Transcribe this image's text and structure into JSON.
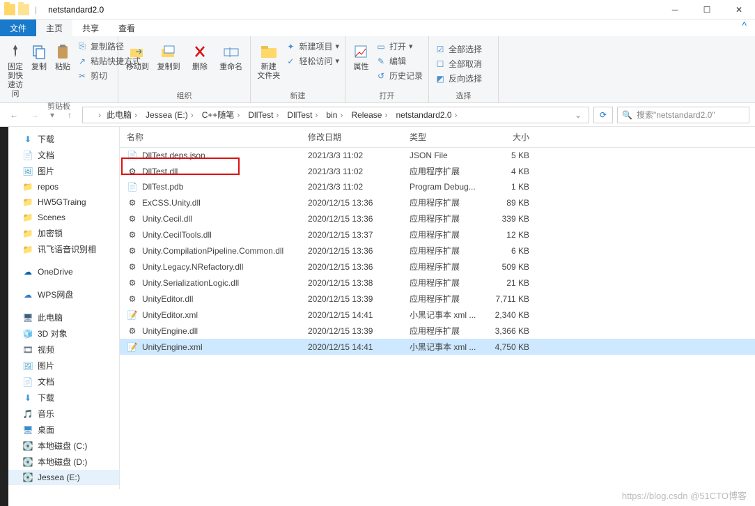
{
  "window": {
    "title": "netstandard2.0"
  },
  "tabs": {
    "file": "文件",
    "home": "主页",
    "share": "共享",
    "view": "查看"
  },
  "ribbon": {
    "pin": "固定到快\n速访问",
    "copy": "复制",
    "paste": "粘贴",
    "copy_path": "复制路径",
    "paste_shortcut": "粘贴快捷方式",
    "cut": "剪切",
    "clipboard": "剪贴板",
    "move_to": "移动到",
    "copy_to": "复制到",
    "delete": "删除",
    "rename": "重命名",
    "organize": "组织",
    "new_folder": "新建\n文件夹",
    "new_item": "新建项目",
    "easy_access": "轻松访问",
    "new": "新建",
    "properties": "属性",
    "open": "打开",
    "edit": "编辑",
    "history": "历史记录",
    "open_grp": "打开",
    "select_all": "全部选择",
    "select_none": "全部取消",
    "invert": "反向选择",
    "select": "选择"
  },
  "breadcrumbs": [
    "此电脑",
    "Jessea (E:)",
    "C++随笔",
    "DllTest",
    "DllTest",
    "bin",
    "Release",
    "netstandard2.0"
  ],
  "search_placeholder": "搜索\"netstandard2.0\"",
  "tree": [
    {
      "label": "下载",
      "ico": "down",
      "color": "#3a9bde"
    },
    {
      "label": "文档",
      "ico": "doc",
      "color": "#5b8ab8"
    },
    {
      "label": "图片",
      "ico": "pic",
      "color": "#4aa3cf"
    },
    {
      "label": "repos",
      "ico": "folder",
      "color": "#ffd869"
    },
    {
      "label": "HW5GTraing",
      "ico": "folder",
      "color": "#e07b3c"
    },
    {
      "label": "Scenes",
      "ico": "folder",
      "color": "#ffd869"
    },
    {
      "label": "加密锁",
      "ico": "folder",
      "color": "#ffd869"
    },
    {
      "label": "讯飞语音识别相",
      "ico": "folder",
      "color": "#ffd869"
    },
    {
      "gap": true
    },
    {
      "label": "OneDrive",
      "ico": "cloud",
      "color": "#0a64a4"
    },
    {
      "gap": true
    },
    {
      "label": "WPS网盘",
      "ico": "cloud2",
      "color": "#2f7bd0"
    },
    {
      "gap": true
    },
    {
      "label": "此电脑",
      "ico": "pc",
      "color": "#3d5f7d"
    },
    {
      "label": "3D 对象",
      "ico": "cube",
      "color": "#35a4a0"
    },
    {
      "label": "视频",
      "ico": "video",
      "color": "#4b5a66"
    },
    {
      "label": "图片",
      "ico": "pic",
      "color": "#4aa3cf"
    },
    {
      "label": "文档",
      "ico": "doc",
      "color": "#5b8ab8"
    },
    {
      "label": "下载",
      "ico": "down",
      "color": "#3a9bde"
    },
    {
      "label": "音乐",
      "ico": "music",
      "color": "#2f6fb2"
    },
    {
      "label": "桌面",
      "ico": "desktop",
      "color": "#3a8bc8"
    },
    {
      "label": "本地磁盘 (C:)",
      "ico": "drive",
      "color": "#8a8a8a"
    },
    {
      "label": "本地磁盘 (D:)",
      "ico": "drive",
      "color": "#8a8a8a"
    },
    {
      "label": "Jessea (E:)",
      "ico": "drive",
      "color": "#8a8a8a",
      "sel": true
    }
  ],
  "columns": {
    "name": "名称",
    "date": "修改日期",
    "type": "类型",
    "size": "大小"
  },
  "files": [
    {
      "name": "DllTest.deps.json",
      "date": "2021/3/3 11:02",
      "type": "JSON File",
      "size": "5 KB",
      "ico": "json"
    },
    {
      "name": "DllTest.dll",
      "date": "2021/3/3 11:02",
      "type": "应用程序扩展",
      "size": "4 KB",
      "ico": "dll",
      "highlight": true
    },
    {
      "name": "DllTest.pdb",
      "date": "2021/3/3 11:02",
      "type": "Program Debug...",
      "size": "1 KB",
      "ico": "pdb"
    },
    {
      "name": "ExCSS.Unity.dll",
      "date": "2020/12/15 13:36",
      "type": "应用程序扩展",
      "size": "89 KB",
      "ico": "dll"
    },
    {
      "name": "Unity.Cecil.dll",
      "date": "2020/12/15 13:36",
      "type": "应用程序扩展",
      "size": "339 KB",
      "ico": "dll"
    },
    {
      "name": "Unity.CecilTools.dll",
      "date": "2020/12/15 13:37",
      "type": "应用程序扩展",
      "size": "12 KB",
      "ico": "dll"
    },
    {
      "name": "Unity.CompilationPipeline.Common.dll",
      "date": "2020/12/15 13:36",
      "type": "应用程序扩展",
      "size": "6 KB",
      "ico": "dll"
    },
    {
      "name": "Unity.Legacy.NRefactory.dll",
      "date": "2020/12/15 13:36",
      "type": "应用程序扩展",
      "size": "509 KB",
      "ico": "dll"
    },
    {
      "name": "Unity.SerializationLogic.dll",
      "date": "2020/12/15 13:38",
      "type": "应用程序扩展",
      "size": "21 KB",
      "ico": "dll"
    },
    {
      "name": "UnityEditor.dll",
      "date": "2020/12/15 13:39",
      "type": "应用程序扩展",
      "size": "7,711 KB",
      "ico": "dll"
    },
    {
      "name": "UnityEditor.xml",
      "date": "2020/12/15 14:41",
      "type": "小黑记事本 xml ...",
      "size": "2,340 KB",
      "ico": "xml"
    },
    {
      "name": "UnityEngine.dll",
      "date": "2020/12/15 13:39",
      "type": "应用程序扩展",
      "size": "3,366 KB",
      "ico": "dll"
    },
    {
      "name": "UnityEngine.xml",
      "date": "2020/12/15 14:41",
      "type": "小黑记事本 xml ...",
      "size": "4,750 KB",
      "ico": "xml",
      "sel": true
    }
  ],
  "watermark": "https://blog.csdn @51CTO博客"
}
